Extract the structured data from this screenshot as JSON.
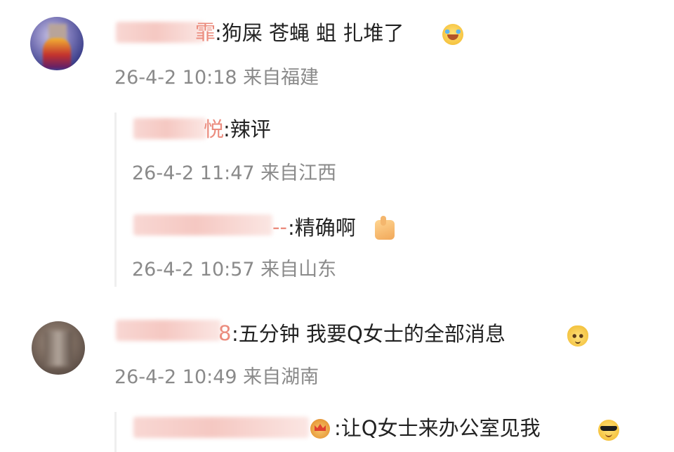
{
  "comments": [
    {
      "name_tail": "霏",
      "text": ":狗屎 苍蝇 蛆 扎堆了",
      "emoji": "laughing-crying-emoji",
      "meta": "26-4-2 10:18 来自福建"
    },
    {
      "name_tail": "悦",
      "text": ":辣评",
      "meta": "26-4-2 11:47 来自江西"
    },
    {
      "name_tail": "--",
      "text": ":精确啊",
      "emoji": "thumbs-up-emoji",
      "meta": "26-4-2 10:57 来自山东"
    },
    {
      "name_tail": "8",
      "text": ":五分钟 我要Q女士的全部消息",
      "emoji": "smug-cat-emoji",
      "meta": "26-4-2 10:49 来自湖南"
    },
    {
      "name_tail": "",
      "text": ":让Q女士来办公室见我",
      "emoji": "sunglasses-emoji",
      "badge_icon": "crown-badge-icon"
    }
  ]
}
